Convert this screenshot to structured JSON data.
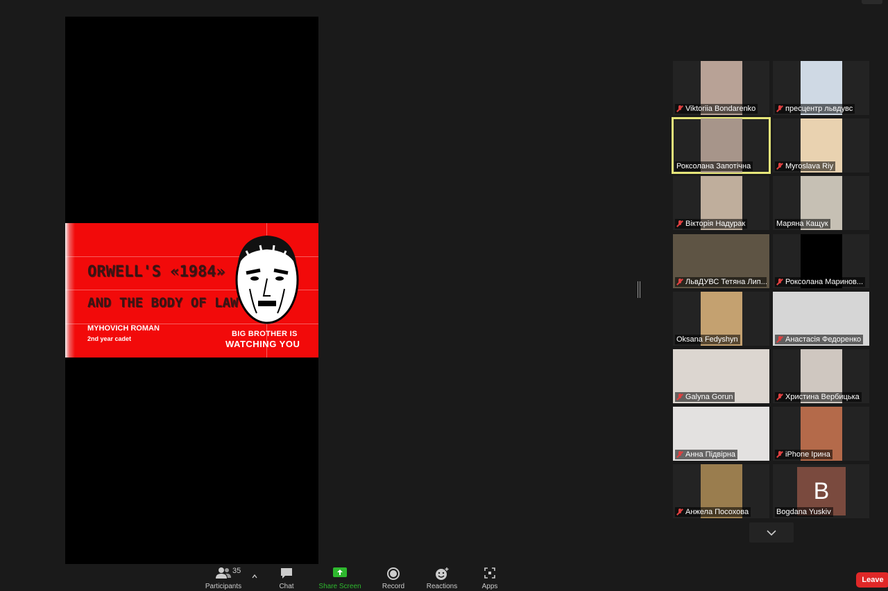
{
  "slide": {
    "title": "ORWELL'S «1984»",
    "subtitle": "AND THE BODY OF LAW",
    "author": "MYHOVICH ROMAN",
    "year": "2nd year cadet",
    "slogan_line1": "BIG BROTHER IS",
    "slogan_line2": "WATCHING YOU"
  },
  "participants": [
    {
      "name": "Viktoriia Bondarenko",
      "muted": true,
      "icon": "mic-muted-icon",
      "video_color": "#b8a296",
      "active": false
    },
    {
      "name": "пресцентр львдувс",
      "muted": true,
      "icon": "mic-muted-icon",
      "video_color": "#cfd9e4",
      "active": false
    },
    {
      "name": "Роксолана Запотічна",
      "muted": false,
      "icon": "",
      "video_color": "#a7958a",
      "active": true
    },
    {
      "name": "Myroslava Riy",
      "muted": true,
      "icon": "mic-muted-icon",
      "video_color": "#e9d2b0",
      "active": false
    },
    {
      "name": "Вікторія Надурак",
      "muted": true,
      "icon": "mic-muted-icon",
      "video_color": "#bfae9c",
      "active": false
    },
    {
      "name": "Маряна Кащук",
      "muted": false,
      "icon": "",
      "video_color": "#c6c0b4",
      "active": false
    },
    {
      "name": "ЛьвДУВС Тетяна Лип...",
      "muted": true,
      "icon": "mic-muted-icon",
      "video_color": "#5e5444",
      "active": false
    },
    {
      "name": "Роксолана Маринов...",
      "muted": true,
      "icon": "mic-muted-icon",
      "video_color": "#000000",
      "active": false
    },
    {
      "name": "Oksana Fedyshyn",
      "muted": false,
      "icon": "",
      "video_color": "#c4a170",
      "active": false
    },
    {
      "name": "Анастасія Федоренко",
      "muted": true,
      "icon": "mic-muted-icon",
      "video_color": "#d6d6d6",
      "active": false
    },
    {
      "name": "Galyna Gorun",
      "muted": true,
      "icon": "mic-muted-icon",
      "video_color": "#dcd6d0",
      "active": false
    },
    {
      "name": "Христина Вербицька",
      "muted": true,
      "icon": "mic-muted-icon",
      "video_color": "#cfc7c0",
      "active": false
    },
    {
      "name": "Анна Підвірна",
      "muted": true,
      "icon": "mic-muted-icon",
      "video_color": "#e3e1e0",
      "active": false
    },
    {
      "name": "iPhone Ірина",
      "muted": true,
      "icon": "mic-muted-icon",
      "video_color": "#b46a4a",
      "active": false
    },
    {
      "name": "Анжела Посохова",
      "muted": true,
      "icon": "mic-muted-icon",
      "video_color": "#9a7d4e",
      "active": false
    },
    {
      "name": "Bogdana Yuskiv",
      "muted": false,
      "icon": "",
      "avatar_letter": "B",
      "avatar_color": "#7a4a3e",
      "active": false
    }
  ],
  "toolbar": {
    "participants_label": "Participants",
    "participants_count": "35",
    "chat_label": "Chat",
    "share_label": "Share Screen",
    "record_label": "Record",
    "reactions_label": "Reactions",
    "apps_label": "Apps",
    "leave_label": "Leave"
  },
  "colors": {
    "share_green": "#2eb82e",
    "leave_red": "#e02828",
    "active_speaker": "#e6e67a"
  }
}
